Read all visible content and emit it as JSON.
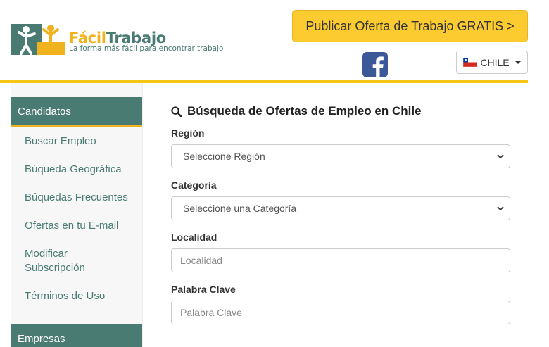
{
  "header": {
    "brand_part1": "Fácil",
    "brand_part2": "Trabajo",
    "tagline": "La forma más fácil para encontrar trabajo",
    "publish_label": "Publicar Oferta de Trabajo GRATIS >",
    "country_label": "CHILE",
    "facebook_icon": "facebook-icon"
  },
  "sidebar": {
    "candidates_heading": "Candidatos",
    "items": [
      {
        "label": "Buscar Empleo"
      },
      {
        "label": "Búqueda Geográfica"
      },
      {
        "label": "Búquedas Frecuentes"
      },
      {
        "label": "Ofertas en tu E-mail"
      },
      {
        "label": "Modificar Subscripción"
      },
      {
        "label": "Términos de Uso"
      }
    ],
    "companies_heading": "Empresas"
  },
  "search": {
    "title": "Búsqueda de Ofertas de Empleo en Chile",
    "region_label": "Región",
    "region_value": "Seleccione Región",
    "category_label": "Categoría",
    "category_value": "Seleccione una Categoría",
    "locality_label": "Localidad",
    "locality_placeholder": "Localidad",
    "keyword_label": "Palabra Clave",
    "keyword_placeholder": "Palabra Clave"
  },
  "colors": {
    "accent_yellow": "#fccb2f",
    "brand_green": "#4a7b73",
    "brand_yellow": "#f0b31d",
    "facebook_blue": "#3b5998"
  }
}
